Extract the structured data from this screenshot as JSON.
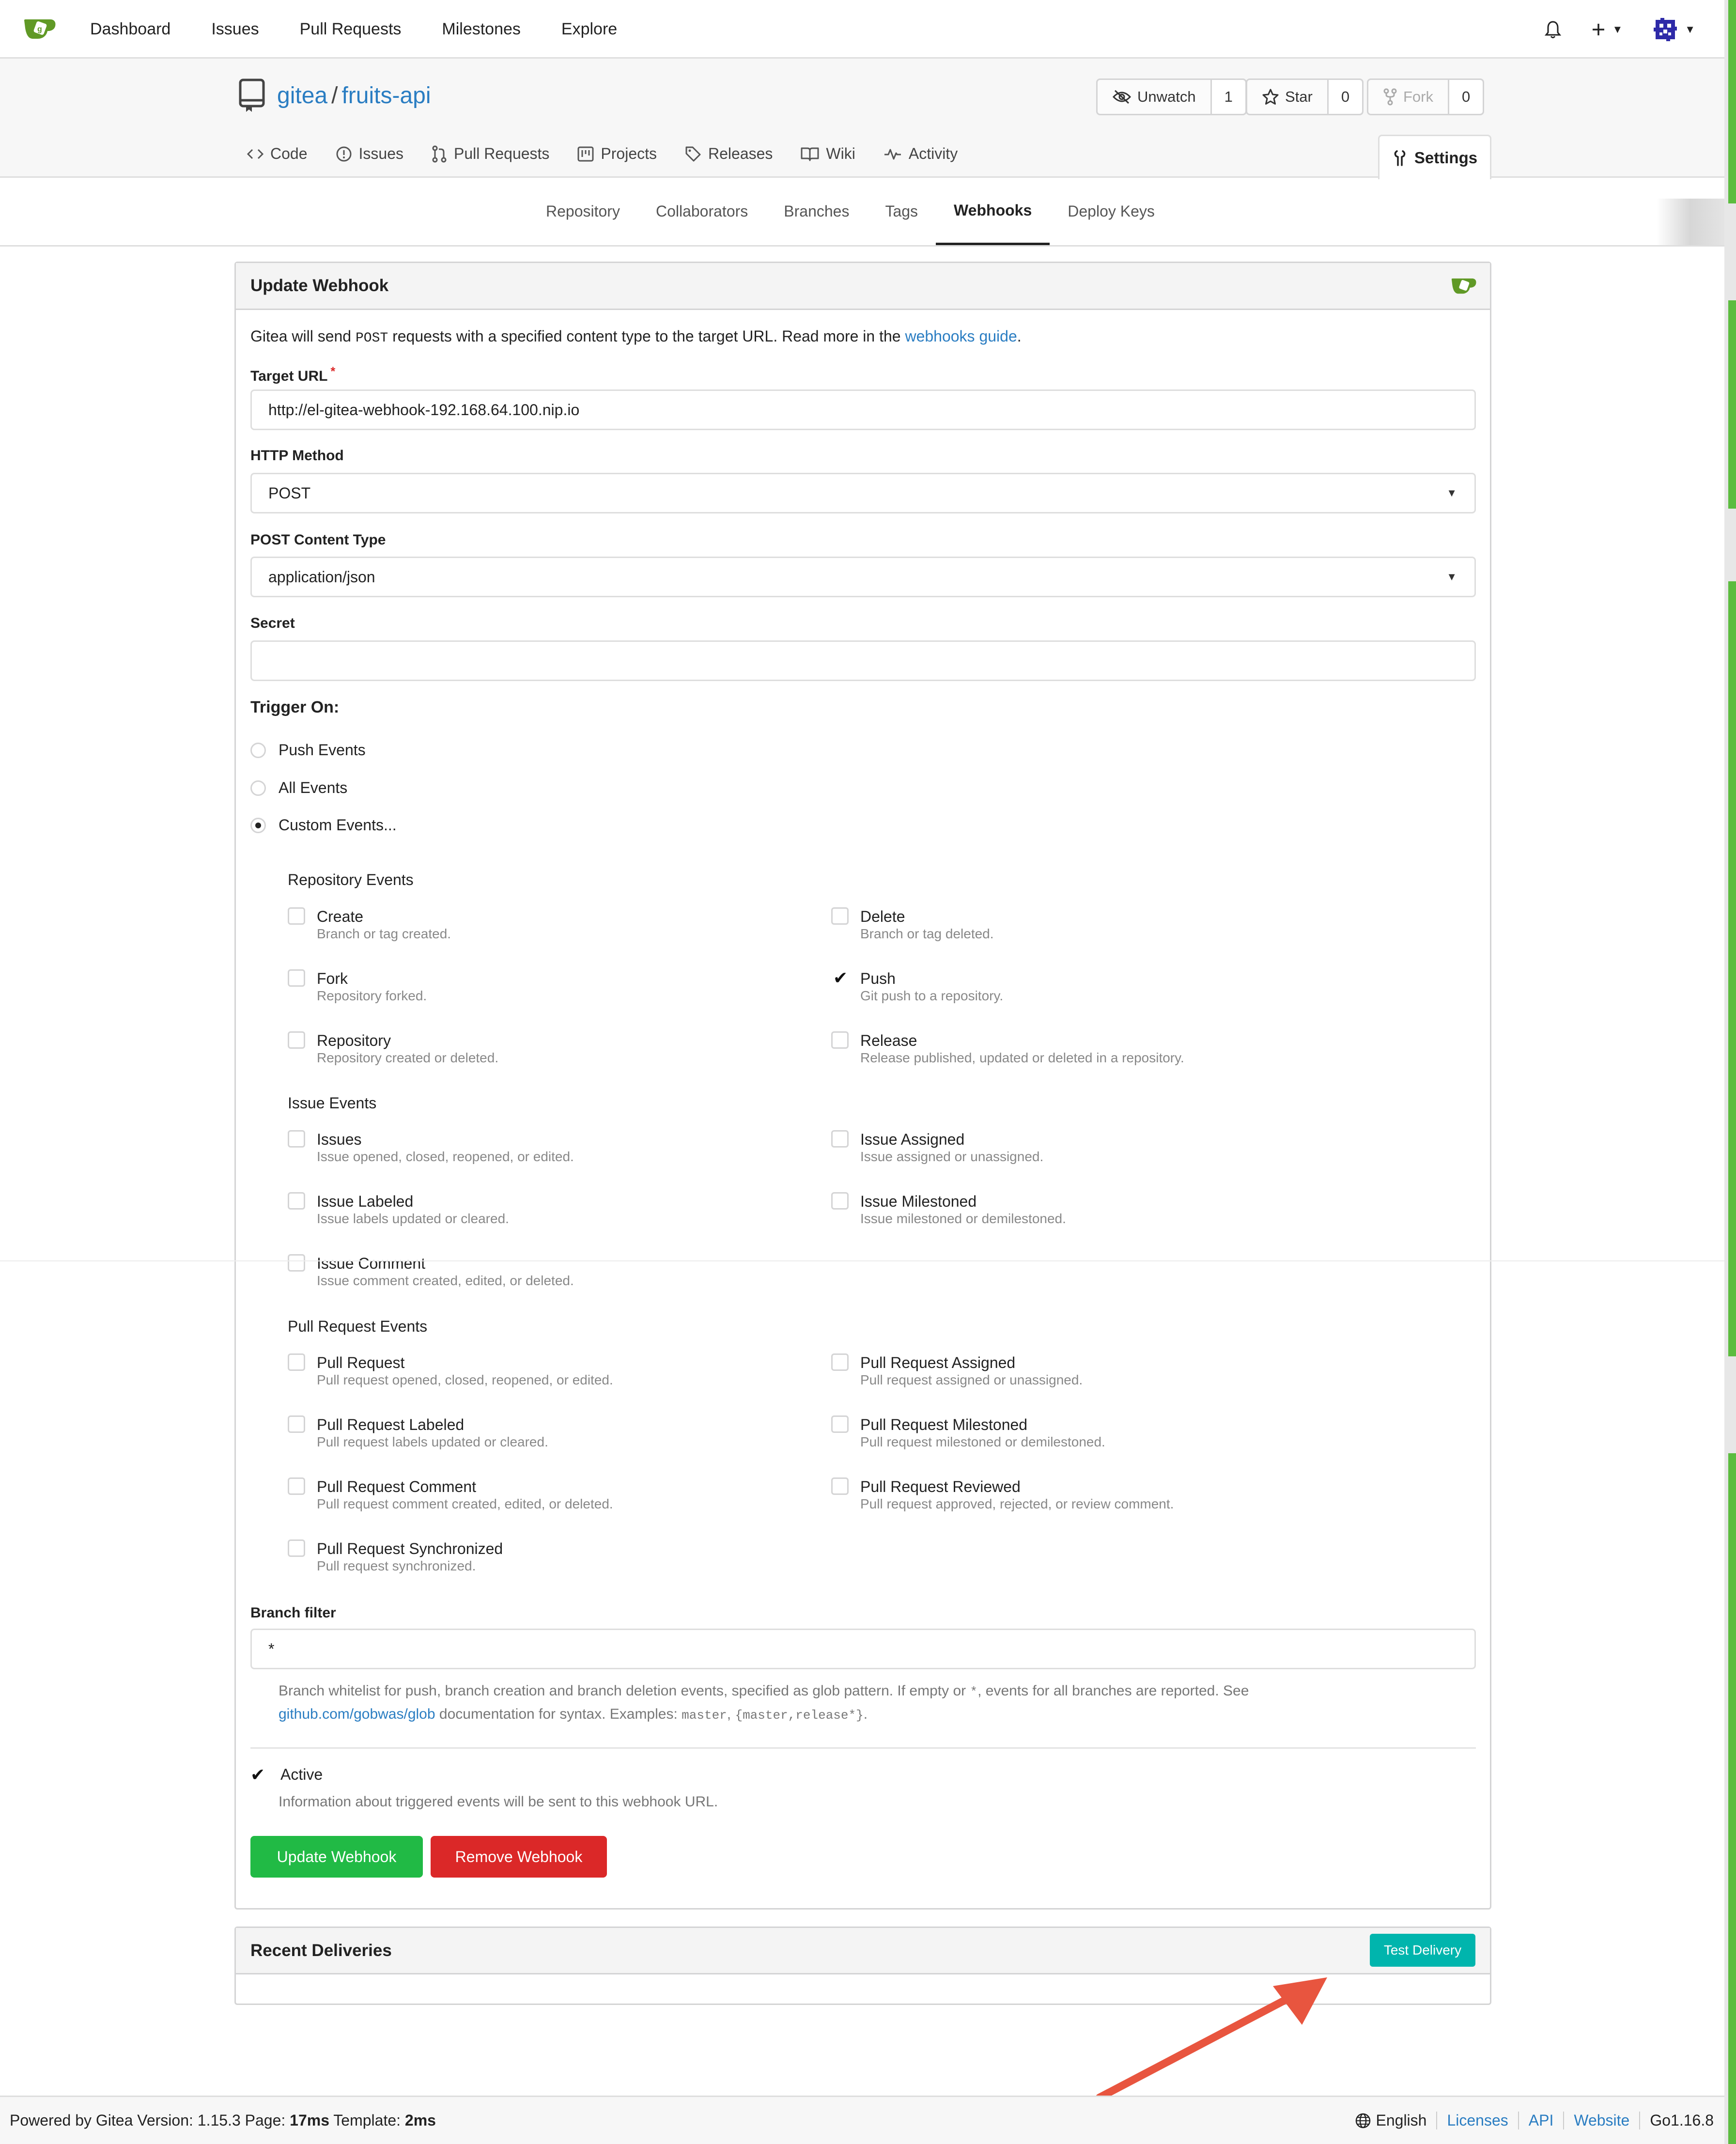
{
  "nav": {
    "links": [
      "Dashboard",
      "Issues",
      "Pull Requests",
      "Milestones",
      "Explore"
    ]
  },
  "repo": {
    "owner": "gitea",
    "separator": "/",
    "name": "fruits-api",
    "watch": {
      "label": "Unwatch",
      "count": "1"
    },
    "star": {
      "label": "Star",
      "count": "0"
    },
    "fork": {
      "label": "Fork",
      "count": "0"
    },
    "tabs": [
      "Code",
      "Issues",
      "Pull Requests",
      "Projects",
      "Releases",
      "Wiki",
      "Activity"
    ],
    "settings_tab": "Settings"
  },
  "submenu": {
    "items": [
      "Repository",
      "Collaborators",
      "Branches",
      "Tags",
      "Webhooks",
      "Deploy Keys"
    ],
    "active": "Webhooks"
  },
  "form": {
    "title": "Update Webhook",
    "intro_prefix": "Gitea will send",
    "intro_code": "POST",
    "intro_mid": "requests with a specified content type to the target URL. Read more in the",
    "intro_link": "webhooks guide",
    "intro_suffix": ".",
    "target_url_label": "Target URL",
    "required_mark": "*",
    "target_url_value": "http://el-gitea-webhook-192.168.64.100.nip.io",
    "http_method_label": "HTTP Method",
    "http_method_value": "POST",
    "content_type_label": "POST Content Type",
    "content_type_value": "application/json",
    "secret_label": "Secret",
    "secret_value": "",
    "trigger_label": "Trigger On:",
    "trigger_options": [
      {
        "label": "Push Events",
        "selected": false
      },
      {
        "label": "All Events",
        "selected": false
      },
      {
        "label": "Custom Events...",
        "selected": true
      }
    ],
    "groups": {
      "repository": "Repository Events",
      "issue": "Issue Events",
      "pull": "Pull Request Events"
    },
    "events": {
      "create": {
        "title": "Create",
        "desc": "Branch or tag created.",
        "checked": false
      },
      "delete": {
        "title": "Delete",
        "desc": "Branch or tag deleted.",
        "checked": false
      },
      "fork": {
        "title": "Fork",
        "desc": "Repository forked.",
        "checked": false
      },
      "push": {
        "title": "Push",
        "desc": "Git push to a repository.",
        "checked": true
      },
      "repository": {
        "title": "Repository",
        "desc": "Repository created or deleted.",
        "checked": false
      },
      "release": {
        "title": "Release",
        "desc": "Release published, updated or deleted in a repository.",
        "checked": false
      },
      "issues": {
        "title": "Issues",
        "desc": "Issue opened, closed, reopened, or edited.",
        "checked": false
      },
      "issue_assigned": {
        "title": "Issue Assigned",
        "desc": "Issue assigned or unassigned.",
        "checked": false
      },
      "issue_labeled": {
        "title": "Issue Labeled",
        "desc": "Issue labels updated or cleared.",
        "checked": false
      },
      "issue_milestoned": {
        "title": "Issue Milestoned",
        "desc": "Issue milestoned or demilestoned.",
        "checked": false
      },
      "issue_comment": {
        "title": "Issue Comment",
        "desc": "Issue comment created, edited, or deleted.",
        "checked": false
      },
      "pull_request": {
        "title": "Pull Request",
        "desc": "Pull request opened, closed, reopened, or edited.",
        "checked": false
      },
      "pr_assigned": {
        "title": "Pull Request Assigned",
        "desc": "Pull request assigned or unassigned.",
        "checked": false
      },
      "pr_labeled": {
        "title": "Pull Request Labeled",
        "desc": "Pull request labels updated or cleared.",
        "checked": false
      },
      "pr_milestoned": {
        "title": "Pull Request Milestoned",
        "desc": "Pull request milestoned or demilestoned.",
        "checked": false
      },
      "pr_comment": {
        "title": "Pull Request Comment",
        "desc": "Pull request comment created, edited, or deleted.",
        "checked": false
      },
      "pr_reviewed": {
        "title": "Pull Request Reviewed",
        "desc": "Pull request approved, rejected, or review comment.",
        "checked": false
      },
      "pr_sync": {
        "title": "Pull Request Synchronized",
        "desc": "Pull request synchronized.",
        "checked": false
      }
    },
    "branch_filter_label": "Branch filter",
    "branch_filter_value": "*",
    "branch_help_1": "Branch whitelist for push, branch creation and branch deletion events, specified as glob pattern. If empty or",
    "branch_help_code1": "*",
    "branch_help_2": ", events for all branches are reported. See",
    "branch_help_link": "github.com/gobwas/glob",
    "branch_help_3": "documentation for syntax. Examples:",
    "branch_help_code2": "master",
    "branch_help_comma": ",",
    "branch_help_code3": "{master,release*}",
    "branch_help_end": ".",
    "active_label": "Active",
    "active_checked": true,
    "active_help": "Information about triggered events will be sent to this webhook URL.",
    "update_button": "Update Webhook",
    "remove_button": "Remove Webhook"
  },
  "deliveries": {
    "title": "Recent Deliveries",
    "test_button": "Test Delivery"
  },
  "footer": {
    "powered": "Powered by Gitea Version: 1.15.3 Page:",
    "page_time": "17ms",
    "template_label": "Template:",
    "template_time": "2ms",
    "language": "English",
    "links": [
      "Licenses",
      "API",
      "Website"
    ],
    "go_version": "Go1.16.8"
  },
  "colors": {
    "link": "#2a7dc2",
    "green_button": "#21ba45",
    "red_button": "#db2828",
    "teal_button": "#00b5ad",
    "arrow": "#e8553f",
    "gitea_green": "#609926"
  }
}
